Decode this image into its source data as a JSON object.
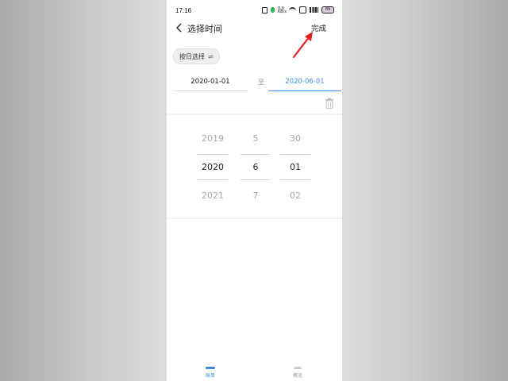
{
  "status_bar": {
    "time": "17:16",
    "network": "0.0 KB/s",
    "battery": "89"
  },
  "header": {
    "title": "选择时间",
    "done_label": "完成"
  },
  "mode_chip": {
    "label": "按日选择",
    "icon": "⇌"
  },
  "range": {
    "start": "2020-01-01",
    "separator": "至",
    "end": "2020-06-01"
  },
  "picker": {
    "year": [
      "2019",
      "2020",
      "2021"
    ],
    "month": [
      "5",
      "6",
      "7"
    ],
    "day": [
      "30",
      "01",
      "02"
    ],
    "selected": {
      "year": "2020",
      "month": "6",
      "day": "01"
    }
  },
  "tabs": [
    {
      "label": "账单",
      "active": true
    },
    {
      "label": "概览",
      "active": false
    }
  ],
  "colors": {
    "accent": "#3a8dde",
    "annotation": "#e02020"
  }
}
